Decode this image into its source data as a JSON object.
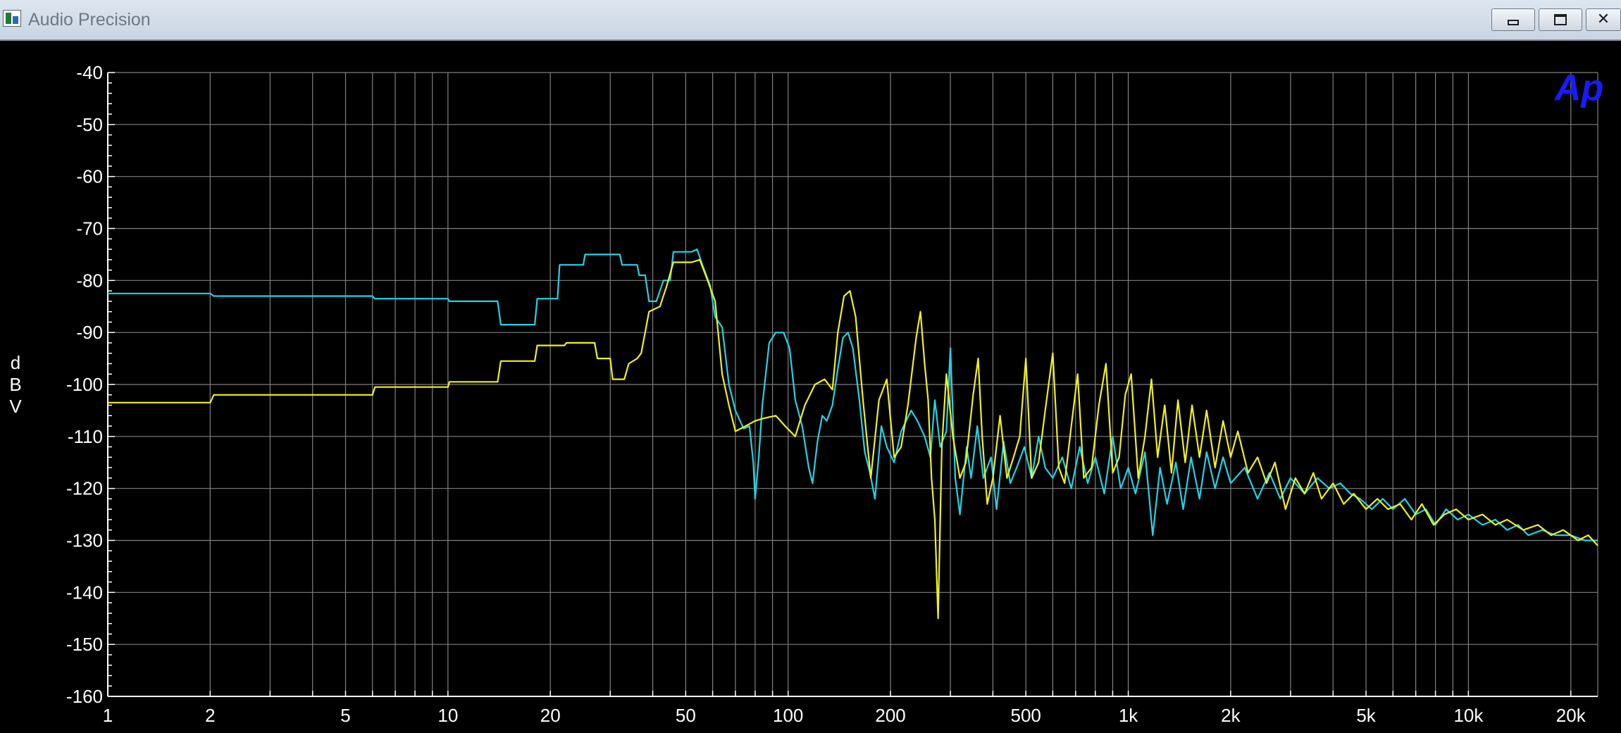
{
  "window": {
    "title": "Audio Precision",
    "icons": {
      "app": "audio-precision-app-icon",
      "minimize": "minimize-icon",
      "maximize": "restore-icon",
      "close": "close-icon"
    },
    "close_glyph": "✕"
  },
  "chart_data": {
    "type": "line",
    "title": "",
    "xlabel": "",
    "ylabel": "dBV",
    "ylabel_chars": [
      "d",
      "B",
      "V"
    ],
    "xscale": "log",
    "xlim": [
      1,
      24000
    ],
    "ylim": [
      -160,
      -40
    ],
    "grid": true,
    "logo_text": "Ap",
    "background": "#000000",
    "grid_color": "#808080",
    "axis_text_color": "#ffffff",
    "logo_color": "#1a1aff",
    "xticks": [
      {
        "value": 1,
        "label": "1"
      },
      {
        "value": 2,
        "label": "2"
      },
      {
        "value": 5,
        "label": "5"
      },
      {
        "value": 10,
        "label": "10"
      },
      {
        "value": 20,
        "label": "20"
      },
      {
        "value": 50,
        "label": "50"
      },
      {
        "value": 100,
        "label": "100"
      },
      {
        "value": 200,
        "label": "200"
      },
      {
        "value": 500,
        "label": "500"
      },
      {
        "value": 1000,
        "label": "1k"
      },
      {
        "value": 2000,
        "label": "2k"
      },
      {
        "value": 5000,
        "label": "5k"
      },
      {
        "value": 10000,
        "label": "10k"
      },
      {
        "value": 20000,
        "label": "20k"
      }
    ],
    "yticks": [
      {
        "value": -40,
        "label": "-40"
      },
      {
        "value": -50,
        "label": "-50"
      },
      {
        "value": -60,
        "label": "-60"
      },
      {
        "value": -70,
        "label": "-70"
      },
      {
        "value": -80,
        "label": "-80"
      },
      {
        "value": -90,
        "label": "-90"
      },
      {
        "value": -100,
        "label": "-100"
      },
      {
        "value": -110,
        "label": "-110"
      },
      {
        "value": -120,
        "label": "-120"
      },
      {
        "value": -130,
        "label": "-130"
      },
      {
        "value": -140,
        "label": "-140"
      },
      {
        "value": -150,
        "label": "-150"
      },
      {
        "value": -160,
        "label": "-160"
      }
    ],
    "series": [
      {
        "color": "#22d3e6",
        "points": [
          [
            1,
            -82.5
          ],
          [
            2,
            -82.5
          ],
          [
            2.05,
            -83
          ],
          [
            6,
            -83
          ],
          [
            6.1,
            -83.5
          ],
          [
            10,
            -83.5
          ],
          [
            10.1,
            -84
          ],
          [
            14,
            -84
          ],
          [
            14.3,
            -88.5
          ],
          [
            18,
            -88.5
          ],
          [
            18.3,
            -83.5
          ],
          [
            21,
            -83.5
          ],
          [
            21.3,
            -77
          ],
          [
            25,
            -77
          ],
          [
            25.3,
            -75
          ],
          [
            32,
            -75
          ],
          [
            32.5,
            -77
          ],
          [
            36,
            -77
          ],
          [
            36.5,
            -79
          ],
          [
            38,
            -79
          ],
          [
            39,
            -84
          ],
          [
            41,
            -84
          ],
          [
            43,
            -80
          ],
          [
            45,
            -80
          ],
          [
            46,
            -74.5
          ],
          [
            52,
            -74.5
          ],
          [
            54,
            -74
          ],
          [
            56,
            -77
          ],
          [
            59,
            -81
          ],
          [
            61,
            -87
          ],
          [
            64,
            -89
          ],
          [
            67,
            -100
          ],
          [
            70,
            -105
          ],
          [
            74,
            -108.5
          ],
          [
            77,
            -108
          ],
          [
            79,
            -115
          ],
          [
            80,
            -122
          ],
          [
            82,
            -114
          ],
          [
            84,
            -104
          ],
          [
            88,
            -92
          ],
          [
            92,
            -90
          ],
          [
            97,
            -90
          ],
          [
            101,
            -93
          ],
          [
            105,
            -103
          ],
          [
            110,
            -108
          ],
          [
            115,
            -116
          ],
          [
            118,
            -119
          ],
          [
            122,
            -111
          ],
          [
            126,
            -106
          ],
          [
            130,
            -107
          ],
          [
            135,
            -104
          ],
          [
            140,
            -97
          ],
          [
            145,
            -91
          ],
          [
            150,
            -90
          ],
          [
            155,
            -93
          ],
          [
            162,
            -103
          ],
          [
            168,
            -113
          ],
          [
            174,
            -117
          ],
          [
            180,
            -122
          ],
          [
            188,
            -108
          ],
          [
            195,
            -112
          ],
          [
            205,
            -115
          ],
          [
            215,
            -109
          ],
          [
            230,
            -105
          ],
          [
            240,
            -107
          ],
          [
            252,
            -110
          ],
          [
            262,
            -114
          ],
          [
            270,
            -103
          ],
          [
            280,
            -112
          ],
          [
            292,
            -109
          ],
          [
            300,
            -93
          ],
          [
            310,
            -118
          ],
          [
            320,
            -125
          ],
          [
            335,
            -112
          ],
          [
            345,
            -118
          ],
          [
            360,
            -108
          ],
          [
            375,
            -118
          ],
          [
            395,
            -114
          ],
          [
            410,
            -124
          ],
          [
            430,
            -111
          ],
          [
            450,
            -119
          ],
          [
            470,
            -116
          ],
          [
            495,
            -112
          ],
          [
            520,
            -118
          ],
          [
            545,
            -110
          ],
          [
            570,
            -116
          ],
          [
            600,
            -118
          ],
          [
            640,
            -114
          ],
          [
            680,
            -120
          ],
          [
            720,
            -112
          ],
          [
            760,
            -119
          ],
          [
            800,
            -114
          ],
          [
            850,
            -121
          ],
          [
            900,
            -110
          ],
          [
            950,
            -120
          ],
          [
            1000,
            -116
          ],
          [
            1050,
            -121
          ],
          [
            1120,
            -113
          ],
          [
            1180,
            -129
          ],
          [
            1240,
            -116
          ],
          [
            1300,
            -123
          ],
          [
            1380,
            -115
          ],
          [
            1450,
            -124
          ],
          [
            1530,
            -114
          ],
          [
            1620,
            -122
          ],
          [
            1700,
            -113
          ],
          [
            1800,
            -120
          ],
          [
            1900,
            -114
          ],
          [
            2000,
            -119
          ],
          [
            2200,
            -116
          ],
          [
            2400,
            -122
          ],
          [
            2600,
            -117
          ],
          [
            2800,
            -122
          ],
          [
            3000,
            -118
          ],
          [
            3300,
            -121
          ],
          [
            3600,
            -118
          ],
          [
            3900,
            -120
          ],
          [
            4200,
            -119
          ],
          [
            4500,
            -121
          ],
          [
            4800,
            -122
          ],
          [
            5200,
            -124
          ],
          [
            5600,
            -122
          ],
          [
            6000,
            -124
          ],
          [
            6500,
            -122
          ],
          [
            7000,
            -125
          ],
          [
            7500,
            -124
          ],
          [
            8000,
            -127
          ],
          [
            8600,
            -124
          ],
          [
            9300,
            -126
          ],
          [
            10000,
            -125
          ],
          [
            11000,
            -127
          ],
          [
            12000,
            -126
          ],
          [
            13000,
            -128
          ],
          [
            14000,
            -127
          ],
          [
            15000,
            -129
          ],
          [
            16500,
            -128
          ],
          [
            18000,
            -129
          ],
          [
            20000,
            -129
          ],
          [
            22000,
            -130
          ],
          [
            24000,
            -130
          ]
        ]
      },
      {
        "color": "#f0f01e",
        "points": [
          [
            1,
            -103.5
          ],
          [
            2,
            -103.5
          ],
          [
            2.05,
            -102
          ],
          [
            6,
            -102
          ],
          [
            6.1,
            -100.5
          ],
          [
            10,
            -100.5
          ],
          [
            10.1,
            -99.5
          ],
          [
            14,
            -99.5
          ],
          [
            14.3,
            -95.5
          ],
          [
            18,
            -95.5
          ],
          [
            18.3,
            -92.5
          ],
          [
            22,
            -92.5
          ],
          [
            22.3,
            -92
          ],
          [
            27,
            -92
          ],
          [
            27.5,
            -95
          ],
          [
            30,
            -95
          ],
          [
            30.5,
            -99
          ],
          [
            33,
            -99
          ],
          [
            34,
            -96
          ],
          [
            36,
            -95
          ],
          [
            37,
            -94
          ],
          [
            39,
            -86
          ],
          [
            42,
            -85
          ],
          [
            44,
            -81
          ],
          [
            46,
            -76.5
          ],
          [
            52,
            -76.5
          ],
          [
            55,
            -76
          ],
          [
            58,
            -80
          ],
          [
            61,
            -84
          ],
          [
            64,
            -98
          ],
          [
            67,
            -104
          ],
          [
            70,
            -109
          ],
          [
            75,
            -108
          ],
          [
            80,
            -107
          ],
          [
            85,
            -106.5
          ],
          [
            92,
            -106
          ],
          [
            98,
            -108
          ],
          [
            105,
            -110
          ],
          [
            112,
            -104
          ],
          [
            120,
            -100
          ],
          [
            128,
            -99
          ],
          [
            135,
            -101
          ],
          [
            140,
            -90
          ],
          [
            146,
            -83
          ],
          [
            152,
            -82
          ],
          [
            158,
            -87
          ],
          [
            166,
            -103
          ],
          [
            175,
            -118
          ],
          [
            185,
            -103
          ],
          [
            195,
            -99
          ],
          [
            205,
            -114
          ],
          [
            215,
            -112
          ],
          [
            225,
            -104
          ],
          [
            238,
            -91
          ],
          [
            245,
            -86
          ],
          [
            252,
            -96
          ],
          [
            258,
            -103
          ],
          [
            264,
            -118
          ],
          [
            270,
            -126
          ],
          [
            276,
            -145
          ],
          [
            283,
            -112
          ],
          [
            292,
            -98
          ],
          [
            305,
            -110
          ],
          [
            320,
            -118
          ],
          [
            333,
            -115
          ],
          [
            350,
            -102
          ],
          [
            362,
            -95
          ],
          [
            372,
            -110
          ],
          [
            385,
            -123
          ],
          [
            400,
            -118
          ],
          [
            420,
            -106
          ],
          [
            440,
            -118
          ],
          [
            460,
            -114
          ],
          [
            480,
            -110
          ],
          [
            500,
            -95
          ],
          [
            520,
            -118
          ],
          [
            545,
            -115
          ],
          [
            570,
            -105
          ],
          [
            600,
            -94
          ],
          [
            625,
            -116
          ],
          [
            650,
            -119
          ],
          [
            680,
            -108
          ],
          [
            710,
            -98
          ],
          [
            740,
            -118
          ],
          [
            780,
            -116
          ],
          [
            820,
            -104
          ],
          [
            860,
            -96
          ],
          [
            900,
            -117
          ],
          [
            940,
            -114
          ],
          [
            980,
            -102
          ],
          [
            1020,
            -98
          ],
          [
            1070,
            -118
          ],
          [
            1120,
            -110
          ],
          [
            1170,
            -99
          ],
          [
            1220,
            -114
          ],
          [
            1280,
            -104
          ],
          [
            1340,
            -117
          ],
          [
            1400,
            -103
          ],
          [
            1470,
            -115
          ],
          [
            1540,
            -104
          ],
          [
            1620,
            -114
          ],
          [
            1700,
            -105
          ],
          [
            1800,
            -116
          ],
          [
            1900,
            -107
          ],
          [
            2000,
            -114
          ],
          [
            2100,
            -109
          ],
          [
            2250,
            -117
          ],
          [
            2400,
            -114
          ],
          [
            2550,
            -119
          ],
          [
            2700,
            -115
          ],
          [
            2900,
            -124
          ],
          [
            3100,
            -118
          ],
          [
            3300,
            -121
          ],
          [
            3500,
            -117
          ],
          [
            3700,
            -122
          ],
          [
            4000,
            -119
          ],
          [
            4300,
            -123
          ],
          [
            4600,
            -121
          ],
          [
            5000,
            -124
          ],
          [
            5400,
            -122
          ],
          [
            5800,
            -124
          ],
          [
            6300,
            -123
          ],
          [
            6800,
            -126
          ],
          [
            7300,
            -123
          ],
          [
            7900,
            -127
          ],
          [
            8500,
            -125
          ],
          [
            9200,
            -124
          ],
          [
            10000,
            -126
          ],
          [
            11000,
            -125
          ],
          [
            12000,
            -127
          ],
          [
            13000,
            -126
          ],
          [
            14500,
            -128
          ],
          [
            16000,
            -127
          ],
          [
            17500,
            -129
          ],
          [
            19000,
            -128
          ],
          [
            21000,
            -130
          ],
          [
            22500,
            -129
          ],
          [
            24000,
            -131
          ]
        ]
      }
    ]
  }
}
